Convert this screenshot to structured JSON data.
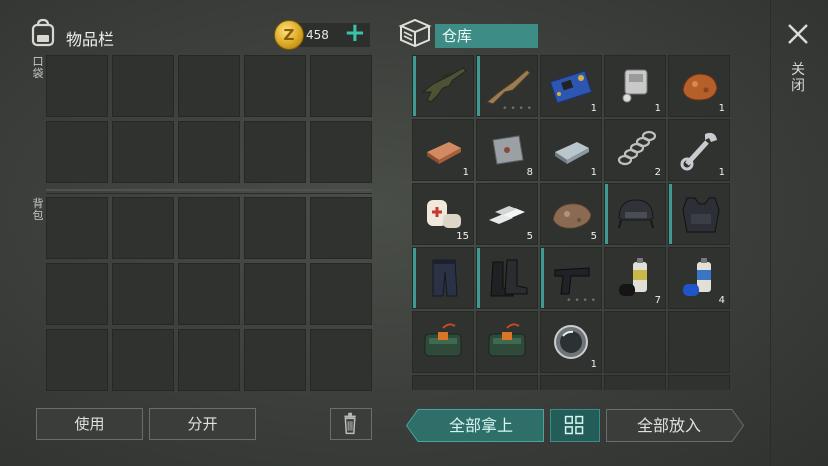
{
  "inventory": {
    "title": "物品栏"
  },
  "currency": {
    "amount": "458",
    "coin_symbol": "Z"
  },
  "warehouse": {
    "tab_label": "仓库"
  },
  "close": {
    "label": "关闭"
  },
  "sections": {
    "pocket_label": "口袋",
    "backpack_label": "背包"
  },
  "buttons": {
    "use": "使用",
    "split": "分开",
    "take_all": "全部拿上",
    "put_all": "全部放入"
  },
  "colors": {
    "accent": "#3e8c86",
    "accent_plus": "#39c3a9",
    "panel": "#2f322f",
    "background": "#3a3d39"
  },
  "warehouse_items": [
    {
      "name": "assault-rifle-dark",
      "count": "",
      "equipped": true,
      "dots": false
    },
    {
      "name": "assault-rifle-tan",
      "count": "",
      "equipped": true,
      "dots": true
    },
    {
      "name": "circuit-board",
      "count": "1",
      "equipped": false,
      "dots": false
    },
    {
      "name": "engine-part",
      "count": "1",
      "equipped": false,
      "dots": false
    },
    {
      "name": "copper-ore",
      "count": "1",
      "equipped": false,
      "dots": false
    },
    {
      "name": "copper-ingot",
      "count": "1",
      "equipped": false,
      "dots": false
    },
    {
      "name": "metal-plate",
      "count": "8",
      "equipped": false,
      "dots": false
    },
    {
      "name": "iron-ingot",
      "count": "1",
      "equipped": false,
      "dots": false
    },
    {
      "name": "spring",
      "count": "2",
      "equipped": false,
      "dots": false
    },
    {
      "name": "wrench",
      "count": "1",
      "equipped": false,
      "dots": false
    },
    {
      "name": "bandage",
      "count": "15",
      "equipped": false,
      "dots": false
    },
    {
      "name": "aluminum-bars",
      "count": "5",
      "equipped": false,
      "dots": false
    },
    {
      "name": "ore-chunk",
      "count": "5",
      "equipped": false,
      "dots": false
    },
    {
      "name": "tactical-helmet",
      "count": "",
      "equipped": true,
      "dots": false
    },
    {
      "name": "tactical-vest",
      "count": "",
      "equipped": true,
      "dots": false
    },
    {
      "name": "tactical-pants",
      "count": "",
      "equipped": true,
      "dots": false
    },
    {
      "name": "combat-boots",
      "count": "",
      "equipped": true,
      "dots": false
    },
    {
      "name": "pistol",
      "count": "",
      "equipped": true,
      "dots": true
    },
    {
      "name": "spray-can-black",
      "count": "7",
      "equipped": false,
      "dots": false
    },
    {
      "name": "spray-can-blue",
      "count": "4",
      "equipped": false,
      "dots": false
    },
    {
      "name": "explosive-bundle",
      "count": "",
      "equipped": false,
      "dots": false
    },
    {
      "name": "explosive-bundle",
      "count": "",
      "equipped": false,
      "dots": false
    },
    {
      "name": "lens",
      "count": "1",
      "equipped": false,
      "dots": false
    },
    {
      "name": "empty",
      "count": "",
      "equipped": false,
      "dots": false
    },
    {
      "name": "empty",
      "count": "",
      "equipped": false,
      "dots": false
    },
    {
      "name": "empty",
      "count": "",
      "equipped": false,
      "dots": false
    },
    {
      "name": "empty",
      "count": "",
      "equipped": false,
      "dots": false
    },
    {
      "name": "empty",
      "count": "",
      "equipped": false,
      "dots": false
    },
    {
      "name": "empty",
      "count": "",
      "equipped": false,
      "dots": false
    },
    {
      "name": "empty",
      "count": "",
      "equipped": false,
      "dots": false
    }
  ]
}
